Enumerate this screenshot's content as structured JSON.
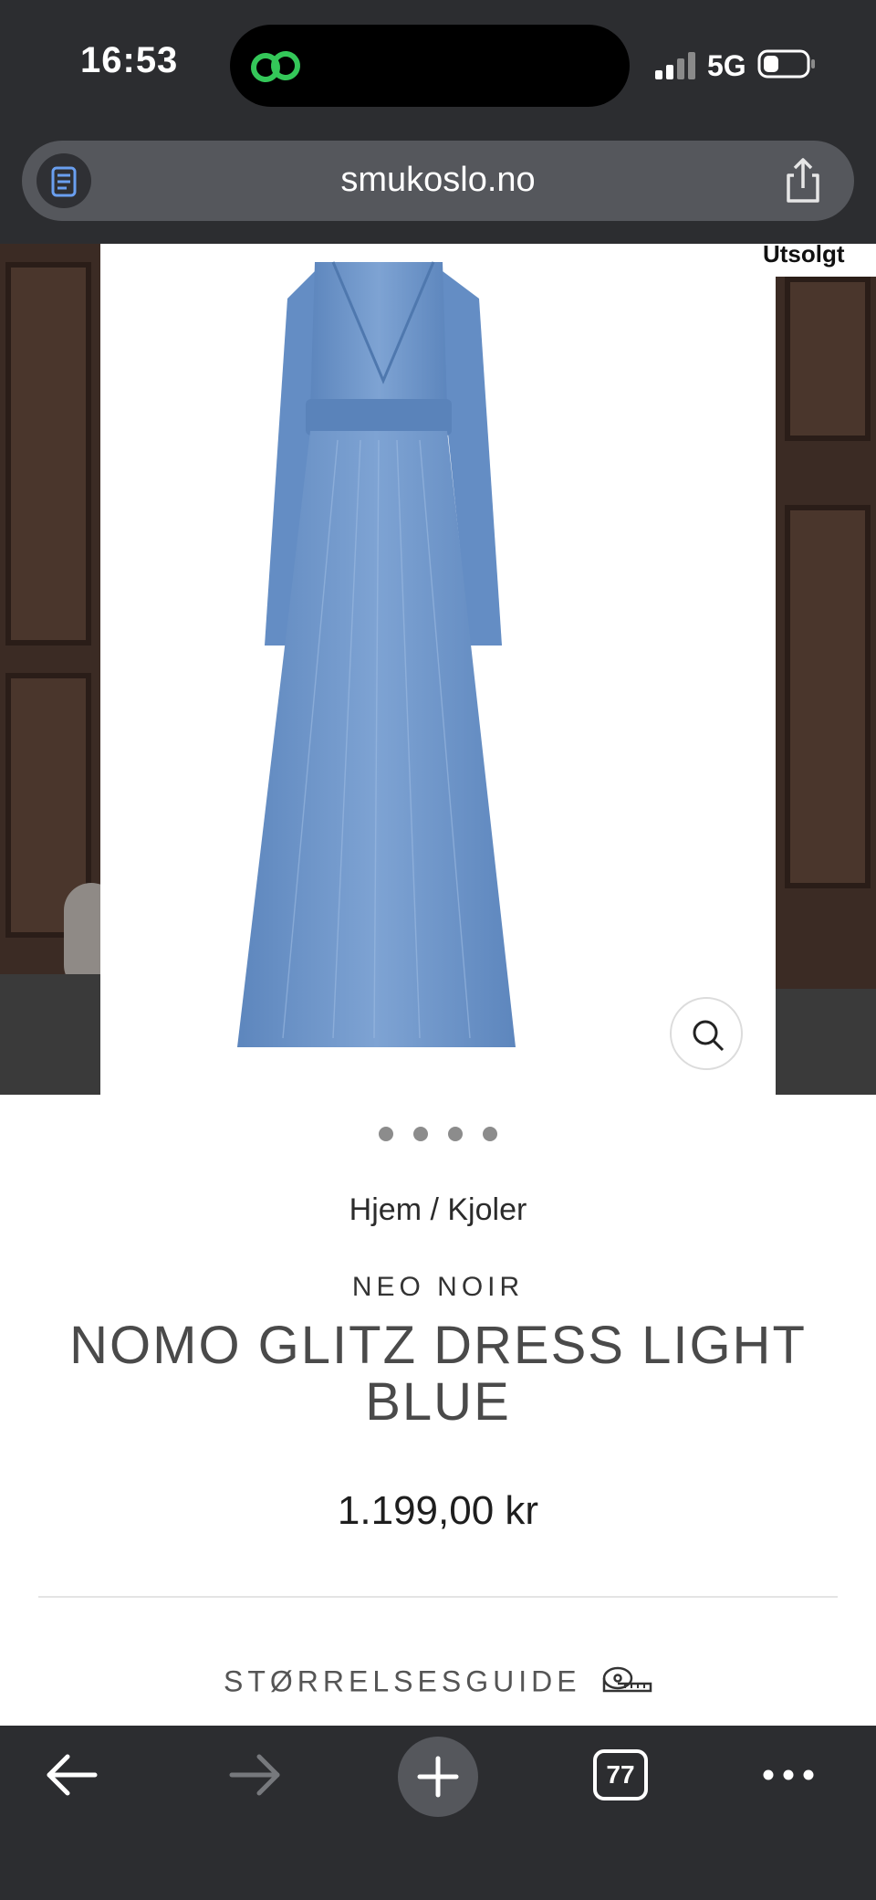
{
  "status_bar": {
    "time": "16:53",
    "network": "5G",
    "icons": [
      "link-icon",
      "signal-icon",
      "battery-icon"
    ]
  },
  "browser": {
    "url": "smukoslo.no",
    "icons": [
      "reader-icon",
      "share-icon"
    ]
  },
  "carousel": {
    "sold_label": "Utsolgt",
    "slide_count": 4,
    "active_slide": 1,
    "colors": {
      "dress": "#6e96c8",
      "door": "#3b2b24"
    }
  },
  "product": {
    "breadcrumb": [
      "Hjem",
      "/",
      "Kjoler"
    ],
    "brand": "NEO NOIR",
    "title": "NOMO GLITZ DRESS LIGHT BLUE",
    "price": "1.199,00 kr",
    "size_guide": "STØRRELSESGUIDE"
  },
  "toolbar": {
    "tabs_count": "77",
    "icons": [
      "back-icon",
      "forward-icon",
      "plus-icon",
      "tabs-icon",
      "more-icon"
    ]
  }
}
